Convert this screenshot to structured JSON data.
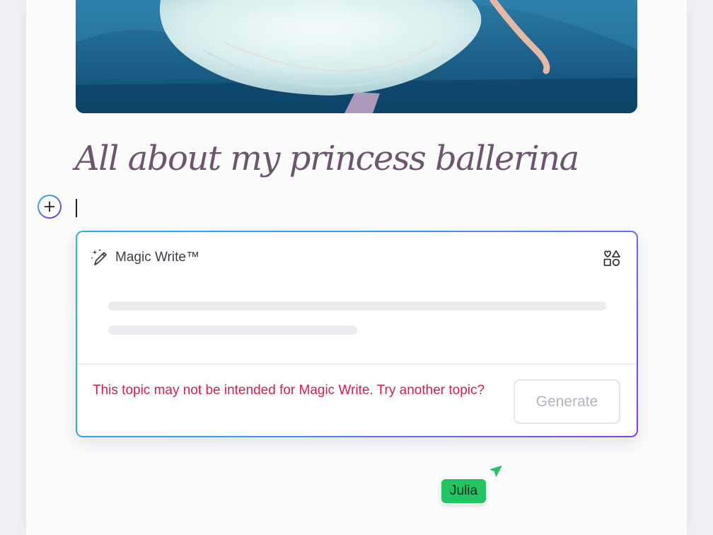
{
  "document": {
    "title": "All about my princess ballerina"
  },
  "editor": {
    "add_block_icon": "plus-icon"
  },
  "magic_write": {
    "icon": "magic-pencil-icon",
    "title": "Magic Write™",
    "elements_icon": "shapes-icon",
    "error_message": "This topic may not be intended for Magic Write. Try another topic?",
    "generate_label": "Generate"
  },
  "collaborator": {
    "name": "Julia",
    "color": "#23c463",
    "cursor_icon": "arrow-cursor-icon"
  },
  "colors": {
    "title": "#6e5470",
    "error": "#d21f4a",
    "gradient_start": "#1fb8e0",
    "gradient_end": "#8b3de6"
  }
}
